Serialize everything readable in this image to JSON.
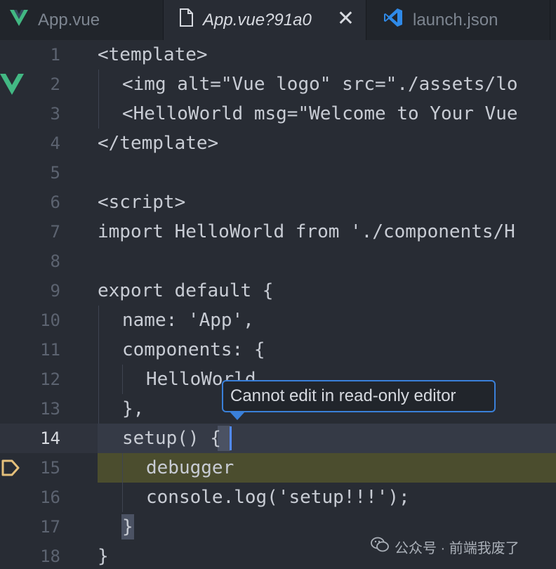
{
  "tabs": [
    {
      "label": "App.vue",
      "icon": "vue-icon",
      "active": false
    },
    {
      "label": "App.vue?91a0",
      "icon": "file-icon",
      "active": true,
      "close": "✕"
    },
    {
      "label": "launch.json",
      "icon": "vscode-icon",
      "active": false
    }
  ],
  "editor": {
    "lines": [
      {
        "n": "1",
        "code": "<template>"
      },
      {
        "n": "2",
        "code": "<img alt=\"Vue logo\" src=\"./assets/lo"
      },
      {
        "n": "3",
        "code": "<HelloWorld msg=\"Welcome to Your Vue"
      },
      {
        "n": "4",
        "code": "</template>"
      },
      {
        "n": "5",
        "code": ""
      },
      {
        "n": "6",
        "code": "<script>"
      },
      {
        "n": "7",
        "code": "import HelloWorld from './components/H"
      },
      {
        "n": "8",
        "code": ""
      },
      {
        "n": "9",
        "code": "export default {"
      },
      {
        "n": "10",
        "code": "name: 'App',"
      },
      {
        "n": "11",
        "code": "components: {"
      },
      {
        "n": "12",
        "code": "HelloWorld"
      },
      {
        "n": "13",
        "code": "},"
      },
      {
        "n": "14",
        "code": "setup() {"
      },
      {
        "n": "15",
        "code": "debugger"
      },
      {
        "n": "16",
        "code": "console.log('setup!!!');"
      },
      {
        "n": "17",
        "code": "}"
      },
      {
        "n": "18",
        "code": "}"
      }
    ],
    "current_line": "14",
    "paused_line": "15"
  },
  "tooltip": {
    "text": "Cannot edit in read-only editor"
  },
  "watermark": {
    "text": "公众号 · 前端我废了",
    "icon": "wechat-icon"
  },
  "colors": {
    "background": "#282c34",
    "tab_bar": "#21252b",
    "debug_line": "#4b4d2e",
    "tooltip_border": "#3a80d9",
    "vue_green": "#42b883",
    "breakpoint": "#e5c07b"
  }
}
